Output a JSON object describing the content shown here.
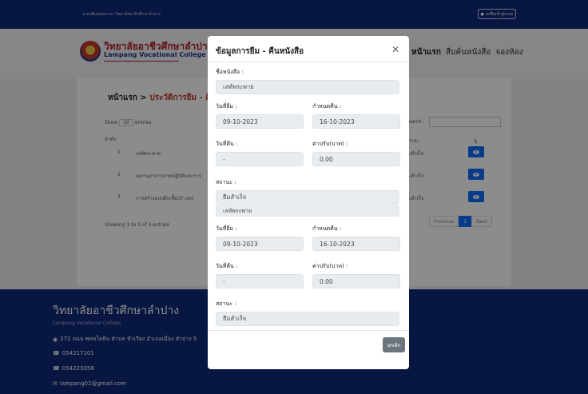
{
  "topbar": {
    "text": "ระบบยืมสมุดตามา วิทยาลัยอาชีวศึกษาลำปาง",
    "login_label": "ลงชื่อเข้าสู่ระบบ"
  },
  "brand": {
    "name_th": "วิทยาลัยอาชีวศึกษาลำปาง",
    "name_en": "Lampang Vocational College"
  },
  "nav": {
    "items": [
      "หน้าแรก",
      "สืบค้นหนังสือ",
      "จองห้อง"
    ]
  },
  "page": {
    "crumb_home": "หน้าแรก",
    "crumb_current": "ประวัติการยืม - คืน",
    "show_label": "Show",
    "show_value": "10",
    "entries_label": "entries",
    "search_label": "Search:",
    "columns": [
      "ลำดับ",
      "ดู"
    ],
    "col_status": "สถานะ",
    "rows": [
      {
        "no": "1",
        "title": "เลห์พระพาย",
        "status": "ยืมสำเร็จ"
      },
      {
        "no": "2",
        "title": "เผยานุภาการภาคปฏิบัติและการ",
        "status": "ยืมสำเร็จ"
      },
      {
        "no": "3",
        "title": "การสร้างแบบฝึกเชื้อเป้า เคร",
        "status": "ยืมสำเร็จ"
      }
    ],
    "showing": "Showing 1 to 3 of 3 entries",
    "pager": {
      "prev": "Previous",
      "current": "1",
      "next": "Next"
    }
  },
  "footer": {
    "title": "วิทยาลัยอาชีวศึกษาลำปาง",
    "subtitle": "Lampang Vocational College",
    "address": "272 ถนน พหลโยธิน ตำบล หัวเวียง อำเภอเมือง ลำปาง 5",
    "phone1": "054217101",
    "phone2": "054223058",
    "email": "lampang02@gmail.com"
  },
  "modal": {
    "title": "ข้อมูลการยืม - คืนหนังสือ",
    "book_label": "ชื่อหนังสือ :",
    "book_name": "เลห์พระพาย",
    "borrow_date_label": "วันที่ยืม :",
    "due_date_label": "กำหนดคืน :",
    "return_date_label": "วันที่คืน :",
    "fine_label": "ค่าปรับ(บาท) :",
    "status_label": "สถานะ :",
    "record1": {
      "borrow_date": "09-10-2023",
      "due_date": "16-10-2023",
      "return_date": "-",
      "fine": "0.00",
      "status": "ยืมสำเร็จ"
    },
    "record2": {
      "book_name": "เลห์พระพาย",
      "borrow_date": "09-10-2023",
      "due_date": "16-10-2023",
      "return_date": "-",
      "fine": "0.00",
      "status": "ยืมสำเร็จ"
    },
    "cancel_label": "ยกเลิก"
  }
}
